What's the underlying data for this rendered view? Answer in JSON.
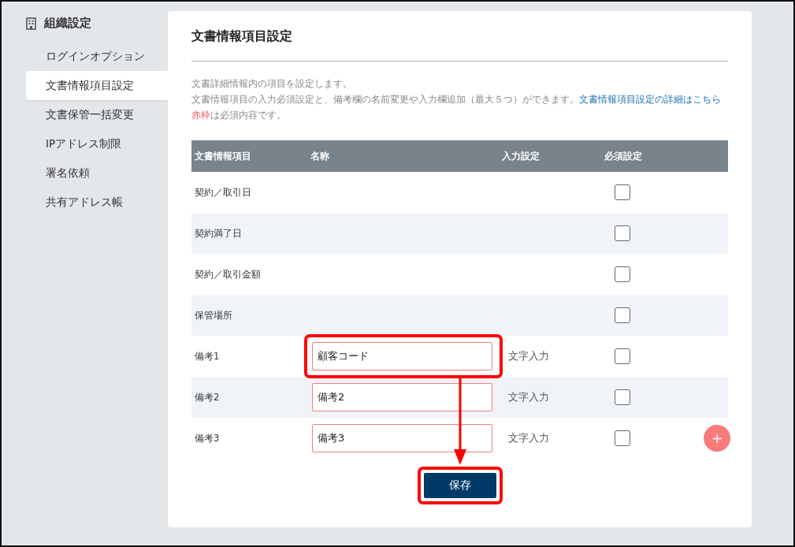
{
  "sidebar": {
    "title": "組織設定",
    "items": [
      {
        "label": "ログインオプション",
        "selected": false
      },
      {
        "label": "文書情報項目設定",
        "selected": true
      },
      {
        "label": "文書保管一括変更",
        "selected": false
      },
      {
        "label": "IPアドレス制限",
        "selected": false
      },
      {
        "label": "署名依頼",
        "selected": false
      },
      {
        "label": "共有アドレス帳",
        "selected": false
      }
    ]
  },
  "panel": {
    "title": "文書情報項目設定",
    "description": [
      {
        "kind": "text",
        "parts": [
          {
            "kind": "plain",
            "text": "文書詳細情報内の項目を設定します。"
          }
        ]
      },
      {
        "kind": "text",
        "parts": [
          {
            "kind": "plain",
            "text": "文書情報項目の入力必須設定と、備考欄の名前変更や入力欄追加（最大５つ）ができます。"
          },
          {
            "kind": "link",
            "text": "文書情報項目設定の詳細はこちら"
          }
        ]
      },
      {
        "kind": "text",
        "parts": [
          {
            "kind": "red",
            "text": "赤枠"
          },
          {
            "kind": "plain",
            "text": "は必須内容です。"
          }
        ]
      }
    ],
    "table": {
      "columns": [
        "文書情報項目",
        "名称",
        "入力設定",
        "必須設定"
      ],
      "rows": [
        {
          "kind": "fixed",
          "item": "契約／取引日",
          "checked": false
        },
        {
          "kind": "fixed",
          "item": "契約満了日",
          "checked": false
        },
        {
          "kind": "fixed",
          "item": "契約／取引金額",
          "checked": false
        },
        {
          "kind": "fixed",
          "item": "保管場所",
          "checked": false
        },
        {
          "kind": "remark",
          "item": "備考1",
          "name": "顧客コード",
          "input_type": "文字入力",
          "checked": false,
          "highlighted": true
        },
        {
          "kind": "remark",
          "item": "備考2",
          "name": "備考2",
          "input_type": "文字入力",
          "checked": false,
          "highlighted": false
        },
        {
          "kind": "remark",
          "item": "備考3",
          "name": "備考3",
          "input_type": "文字入力",
          "checked": false,
          "highlighted": false,
          "add_label": "+"
        }
      ]
    },
    "save_button": {
      "label": "保存",
      "highlighted": true
    }
  }
}
